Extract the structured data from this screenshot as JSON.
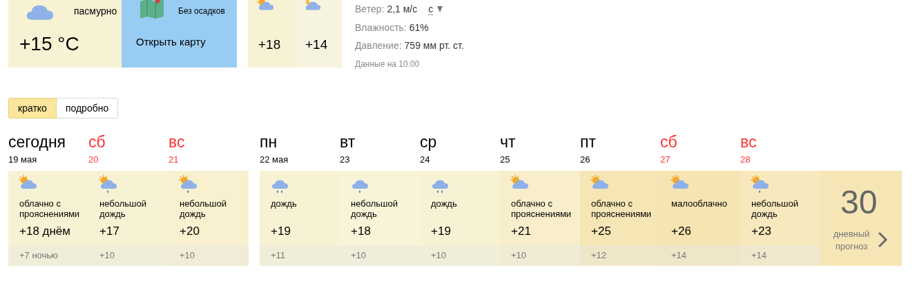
{
  "current": {
    "kind": "cloudy",
    "condition": "пасмурно",
    "temperature": "+15 °C"
  },
  "map": {
    "label": "Без осадков",
    "link": "Открыть карту"
  },
  "parts": [
    {
      "kind": "partly-cloudy",
      "temperature": "+18"
    },
    {
      "kind": "night-cloudy",
      "temperature": "+14"
    }
  ],
  "details": {
    "wind_label": "Ветер:",
    "wind_value": "2,1 м/с",
    "wind_direction": "с",
    "humidity_label": "Влажность:",
    "humidity_value": "61%",
    "pressure_label": "Давление:",
    "pressure_value": "759 мм рт. ст.",
    "updated": "Данные на 10:00"
  },
  "view_tabs": [
    {
      "label": "кратко",
      "selected": true
    },
    {
      "label": "подробно",
      "selected": false
    }
  ],
  "day_groups": [
    [
      {
        "name": "сегодня",
        "date": "19 мая",
        "weekend": false,
        "kind": "partly-cloudy",
        "condition": "облачно с прояснениями",
        "day": "+18 днём",
        "night": "+7 ночью",
        "color": "#f8f2d4"
      },
      {
        "name": "сб",
        "date": "20",
        "weekend": true,
        "kind": "partly-cloudy-light-rain",
        "condition": "небольшой дождь",
        "day": "+17",
        "night": "+10",
        "color": "#f8f2d4"
      },
      {
        "name": "вс",
        "date": "21",
        "weekend": true,
        "kind": "partly-cloudy-light-rain",
        "condition": "небольшой дождь",
        "day": "+20",
        "night": "+10",
        "color": "#f8f0cf"
      }
    ],
    [
      {
        "name": "пн",
        "date": "22 мая",
        "weekend": false,
        "kind": "rain",
        "condition": "дождь",
        "day": "+19",
        "night": "+11",
        "color": "#f8f2d4"
      },
      {
        "name": "вт",
        "date": "23",
        "weekend": false,
        "kind": "light-rain",
        "condition": "небольшой дождь",
        "day": "+18",
        "night": "+10",
        "color": "#f8f4d8"
      },
      {
        "name": "ср",
        "date": "24",
        "weekend": false,
        "kind": "rain",
        "condition": "дождь",
        "day": "+19",
        "night": "+10",
        "color": "#f8f2d4"
      },
      {
        "name": "чт",
        "date": "25",
        "weekend": false,
        "kind": "partly-cloudy",
        "condition": "облачно с прояснениями",
        "day": "+21",
        "night": "+10",
        "color": "#f8eecb"
      },
      {
        "name": "пт",
        "date": "26",
        "weekend": false,
        "kind": "partly-cloudy",
        "condition": "облачно с прояснениями",
        "day": "+25",
        "night": "+12",
        "color": "#f6e6b6"
      },
      {
        "name": "сб",
        "date": "27",
        "weekend": true,
        "kind": "partly-cloudy",
        "condition": "малооблачно",
        "day": "+26",
        "night": "+14",
        "color": "#f6e4b2"
      },
      {
        "name": "вс",
        "date": "28",
        "weekend": true,
        "kind": "partly-cloudy-light-rain",
        "condition": "небольшой дождь",
        "day": "+23",
        "night": "+14",
        "color": "#f7e9bd"
      }
    ]
  ],
  "month_link": {
    "number": "30",
    "label": "дневный прогноз"
  }
}
